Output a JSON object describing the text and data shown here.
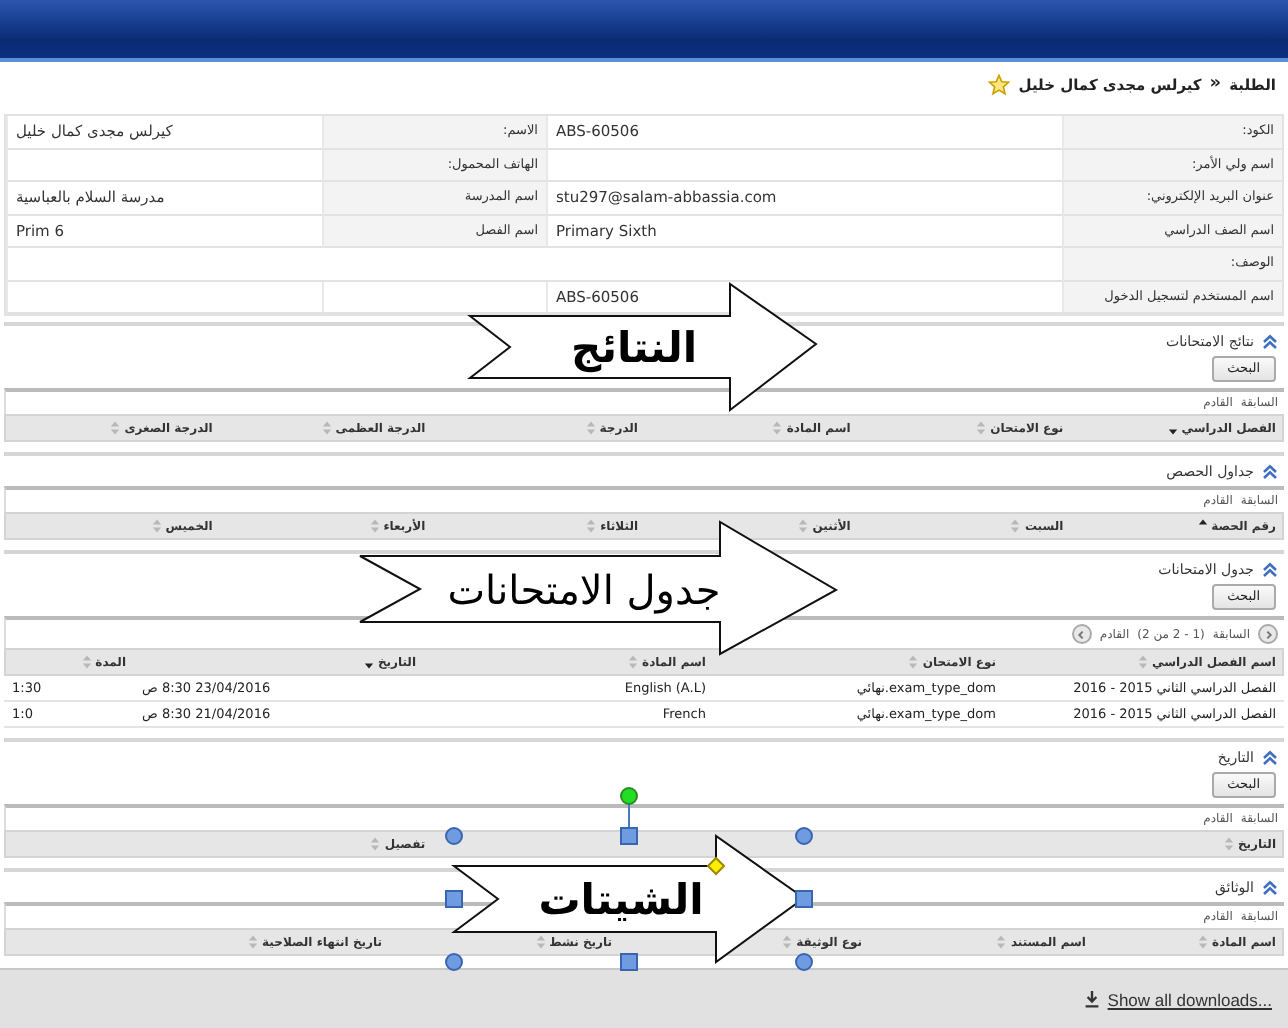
{
  "breadcrumb": {
    "items": [
      "الطلبة",
      "كيرلس مجدى كمال خليل"
    ],
    "separator": "»"
  },
  "info": {
    "rows": [
      [
        {
          "label": "الكود:",
          "value": "ABS-60506"
        },
        {
          "label": "الاسم:",
          "value": "كيرلس مجدى كمال خليل"
        }
      ],
      [
        {
          "label": "اسم ولي الأمر:"
        },
        {
          "label": "الهاتف المحمول:"
        }
      ],
      [
        {
          "label": "عنوان البريد الإلكتروني:",
          "value": "stu297@salam-abbassia.com"
        },
        {
          "label": "اسم المدرسة",
          "value": "مدرسة السلام بالعباسية"
        }
      ],
      [
        {
          "label": "اسم الصف الدراسي",
          "value": "Primary Sixth"
        },
        {
          "label": "اسم الفصل",
          "value": "Prim 6"
        }
      ],
      [
        {
          "label": "الوصف:"
        }
      ],
      [
        {
          "label": "اسم المستخدم لتسجيل الدخول",
          "value": "ABS-60506"
        }
      ]
    ]
  },
  "sections": [
    {
      "title": "نتائج الامتحانات",
      "expanded": true,
      "search_button": "البحث",
      "pager": {
        "prev": "السابقة",
        "next": "القادم"
      },
      "columns": [
        {
          "label": "الفصل الدراسي",
          "sorted_ascending": false,
          "sorted_descending": true
        },
        {
          "label": "نوع الامتحان",
          "sorted_ascending": false,
          "sorted_descending": false
        },
        {
          "label": "اسم المادة",
          "sorted_ascending": false,
          "sorted_descending": false
        },
        {
          "label": "الدرجة",
          "sorted_ascending": false,
          "sorted_descending": false
        },
        {
          "label": "الدرجة العظمى",
          "sorted_ascending": false,
          "sorted_descending": false
        },
        {
          "label": "الدرجة الصغرى",
          "sorted_ascending": false,
          "sorted_descending": false
        }
      ]
    },
    {
      "title": "جداول الحصص",
      "expanded": true,
      "pager": {
        "prev": "السابقة",
        "next": "القادم"
      },
      "columns": [
        {
          "label": "رقم الحصة",
          "sorted_ascending": true,
          "sorted_descending": false
        },
        {
          "label": "السبت",
          "sorted_ascending": false,
          "sorted_descending": false
        },
        {
          "label": "الأثنين",
          "sorted_ascending": false,
          "sorted_descending": false
        },
        {
          "label": "الثلاثاء",
          "sorted_ascending": false,
          "sorted_descending": false
        },
        {
          "label": "الأربعاء",
          "sorted_ascending": false,
          "sorted_descending": false
        },
        {
          "label": "الخميس",
          "sorted_ascending": false,
          "sorted_descending": false
        }
      ]
    },
    {
      "title": "جدول الامتحانات",
      "expanded": true,
      "search_button": "البحث",
      "pager": {
        "prev": "السابقة",
        "range": "(1 - 2 من 2)",
        "next": "القادم"
      },
      "columns": [
        {
          "label": "اسم الفصل الدراسي",
          "sorted_ascending": false,
          "sorted_descending": false
        },
        {
          "label": "نوع الامتحان",
          "sorted_ascending": false,
          "sorted_descending": false
        },
        {
          "label": "اسم المادة",
          "sorted_ascending": false,
          "sorted_descending": false
        },
        {
          "label": "التاريخ",
          "sorted_ascending": false,
          "sorted_descending": true
        },
        {
          "label": "المدة",
          "sorted_ascending": false,
          "sorted_descending": false
        }
      ],
      "rows": [
        [
          "الفصل الدراسي الثاني 2015 - 2016",
          "exam_type_dom.نهائي",
          "English (A.L)",
          "23/04/2016 8:30 ص",
          "1:30"
        ],
        [
          "الفصل الدراسي الثاني 2015 - 2016",
          "exam_type_dom.نهائي",
          "French",
          "21/04/2016 8:30 ص",
          "1:0"
        ]
      ]
    },
    {
      "title": "التاريخ",
      "expanded": true,
      "search_button": "البحث",
      "pager": {
        "prev": "السابقة",
        "next": "القادم"
      },
      "columns": [
        {
          "label": "التاريخ",
          "sorted_ascending": false,
          "sorted_descending": false
        },
        {
          "label": "تفصيل",
          "sorted_ascending": false,
          "sorted_descending": false
        }
      ]
    },
    {
      "title": "الوثائق",
      "expanded": true,
      "pager": {
        "prev": "السابقة",
        "next": "القادم"
      },
      "columns": [
        {
          "label": "اسم المادة",
          "sorted_ascending": false,
          "sorted_descending": false
        },
        {
          "label": "اسم المستند",
          "sorted_ascending": false,
          "sorted_descending": false
        },
        {
          "label": "نوع الوثيقة",
          "sorted_ascending": false,
          "sorted_descending": false
        },
        {
          "label": "تاريخ نشط",
          "sorted_ascending": false,
          "sorted_descending": false
        },
        {
          "label": "تاريخ انتهاء الصلاحية",
          "sorted_ascending": false,
          "sorted_descending": false
        }
      ]
    }
  ],
  "arrows": [
    {
      "text": "النتائج",
      "bold": true,
      "selected": false
    },
    {
      "text": "جدول الامتحانات",
      "bold": false,
      "selected": false
    },
    {
      "text": "الشيتات",
      "bold": true,
      "selected": true
    }
  ],
  "downloads_bar": {
    "link": "Show all downloads..."
  }
}
